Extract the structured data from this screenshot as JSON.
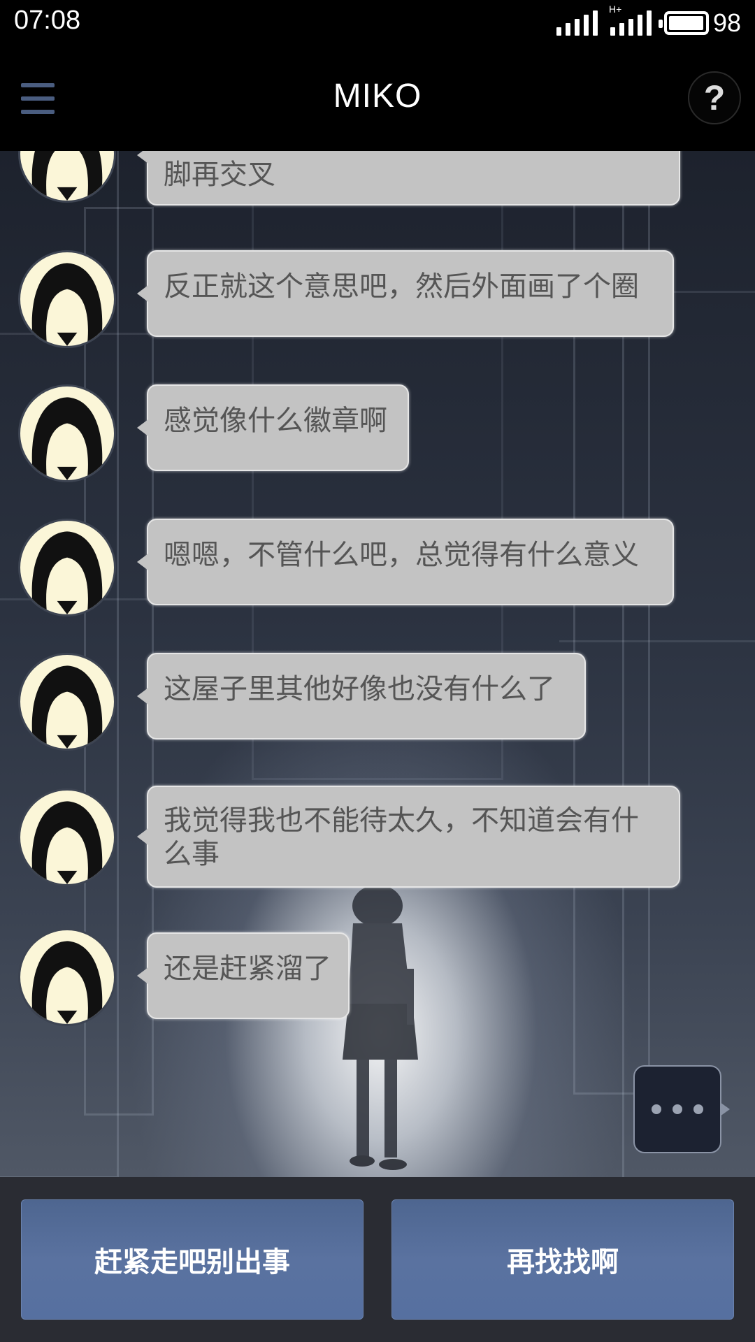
{
  "status_bar": {
    "time": "07:08",
    "network_label": "H+",
    "battery_level": "98"
  },
  "header": {
    "title": "MIKO",
    "menu_icon": "hamburger-menu-icon",
    "help_icon": "question-mark-icon",
    "help_label": "?"
  },
  "messages": [
    {
      "text": "脚再交叉"
    },
    {
      "text": "反正就这个意思吧，然后外面画了个圈"
    },
    {
      "text": "感觉像什么徽章啊"
    },
    {
      "text": "嗯嗯，不管什么吧，总觉得有什么意义"
    },
    {
      "text": "这屋子里其他好像也没有什么了"
    },
    {
      "text": "我觉得我也不能待太久，不知道会有什么事"
    },
    {
      "text": "还是赶紧溜了"
    }
  ],
  "more_button_icon": "ellipsis-icon",
  "choices": [
    {
      "label": "赶紧走吧别出事"
    },
    {
      "label": "再找找啊"
    }
  ],
  "colors": {
    "choice_button": "#5a72a0",
    "bubble": "#c3c3c3",
    "avatar_bg": "#fbf6d8"
  }
}
